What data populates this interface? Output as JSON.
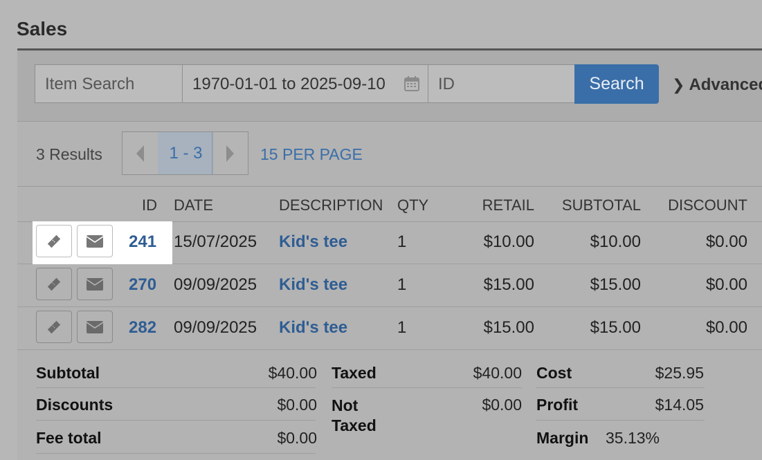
{
  "page": {
    "title": "Sales"
  },
  "search": {
    "item_placeholder": "Item Search",
    "date_range": "1970-01-01 to 2025-09-10",
    "id_placeholder": "ID",
    "search_label": "Search",
    "advanced_label": "Advanced"
  },
  "pagination": {
    "results": "3 Results",
    "current": "1 - 3",
    "per_page": "15 PER PAGE"
  },
  "table": {
    "columns": [
      "ID",
      "DATE",
      "DESCRIPTION",
      "QTY",
      "RETAIL",
      "SUBTOTAL",
      "DISCOUNT"
    ],
    "rows": [
      {
        "id": "241",
        "date": "15/07/2025",
        "description": "Kid's tee",
        "qty": "1",
        "retail": "$10.00",
        "subtotal": "$10.00",
        "discount": "$0.00"
      },
      {
        "id": "270",
        "date": "09/09/2025",
        "description": "Kid's tee",
        "qty": "1",
        "retail": "$15.00",
        "subtotal": "$15.00",
        "discount": "$0.00"
      },
      {
        "id": "282",
        "date": "09/09/2025",
        "description": "Kid's tee",
        "qty": "1",
        "retail": "$15.00",
        "subtotal": "$15.00",
        "discount": "$0.00"
      }
    ]
  },
  "totals": {
    "subtotal_label": "Subtotal",
    "subtotal": "$40.00",
    "discounts_label": "Discounts",
    "discounts": "$0.00",
    "fee_total_label": "Fee total",
    "fee_total": "$0.00",
    "taxed_label": "Taxed",
    "taxed": "$40.00",
    "not_taxed_label": "Not Taxed",
    "not_taxed": "$0.00",
    "cost_label": "Cost",
    "cost": "$25.95",
    "profit_label": "Profit",
    "profit": "$14.05",
    "margin_label": "Margin",
    "margin": "35.13%"
  },
  "icons": {
    "ticket": "ticket-icon",
    "mail": "envelope-icon",
    "calendar": "calendar-icon",
    "advanced": "chevron-right-icon"
  },
  "colors": {
    "accent": "#3a6ea8",
    "link": "#2f5d93",
    "highlight": "#ffffff"
  }
}
